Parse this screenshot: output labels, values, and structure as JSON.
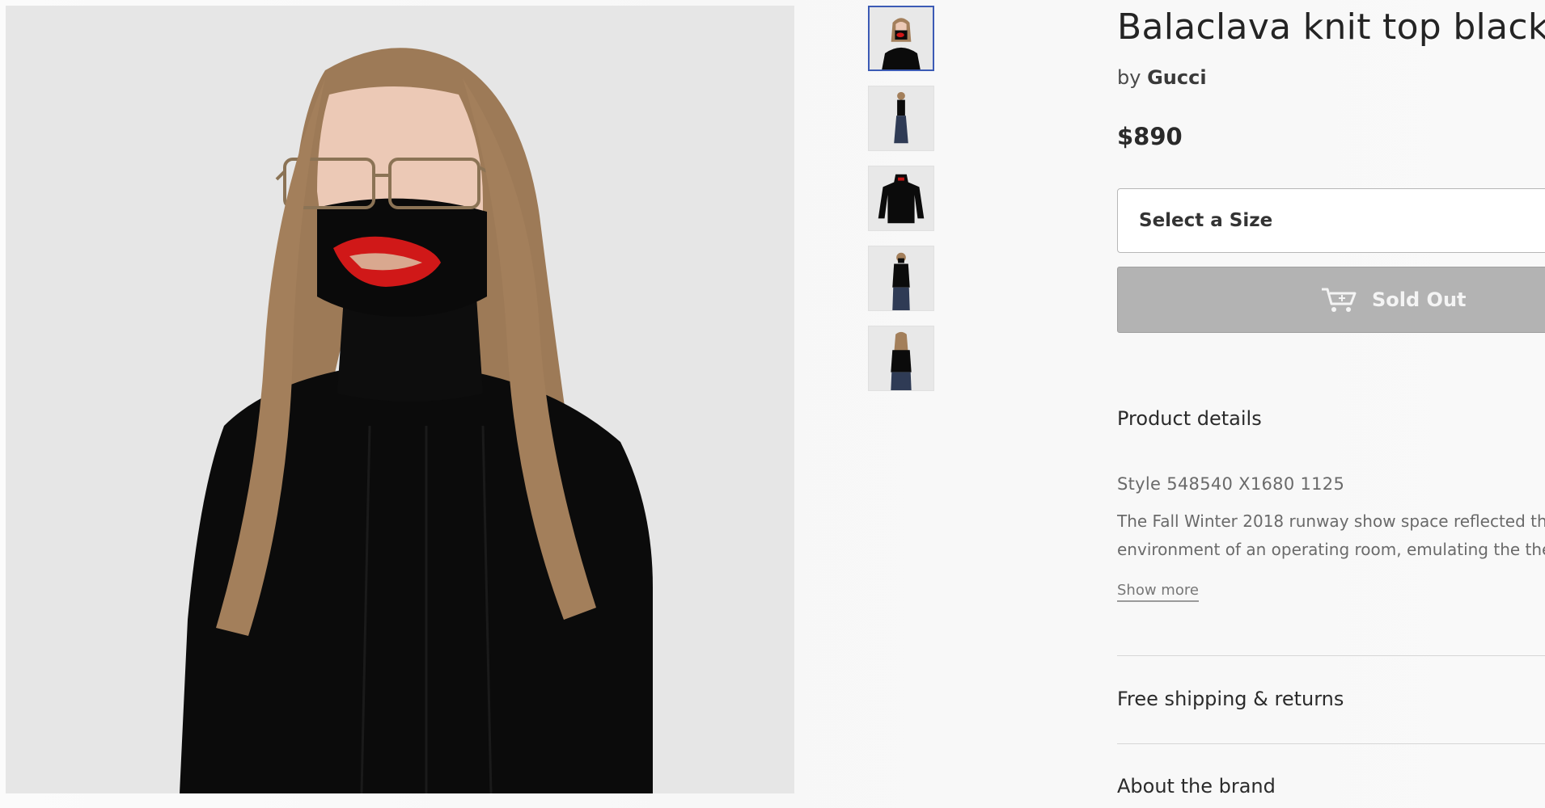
{
  "product": {
    "title": "Balaclava knit top black",
    "by_prefix": "by",
    "brand": "Gucci",
    "price": "$890"
  },
  "purchase": {
    "size_placeholder": "Select a Size",
    "soldout_label": "Sold Out"
  },
  "sections": {
    "product_details": "Product details",
    "style": "Style 548540 X1680 1125",
    "description_line1": "The Fall Winter 2018 runway show space reflected th",
    "description_line2": "environment of an operating room, emulating the ther",
    "show_more": "Show more",
    "shipping": "Free shipping & returns",
    "about_brand": "About the brand"
  },
  "gallery": {
    "thumbnails": [
      "thumbnail-front-closeup",
      "thumbnail-full-length",
      "thumbnail-sweater-flat",
      "thumbnail-model-front",
      "thumbnail-model-back"
    ],
    "selected_index": 0
  },
  "colors": {
    "selected_thumb_border": "#3c5bb5",
    "soldout_bg": "#b3b3b3",
    "photo_bg": "#e6e6e6"
  }
}
